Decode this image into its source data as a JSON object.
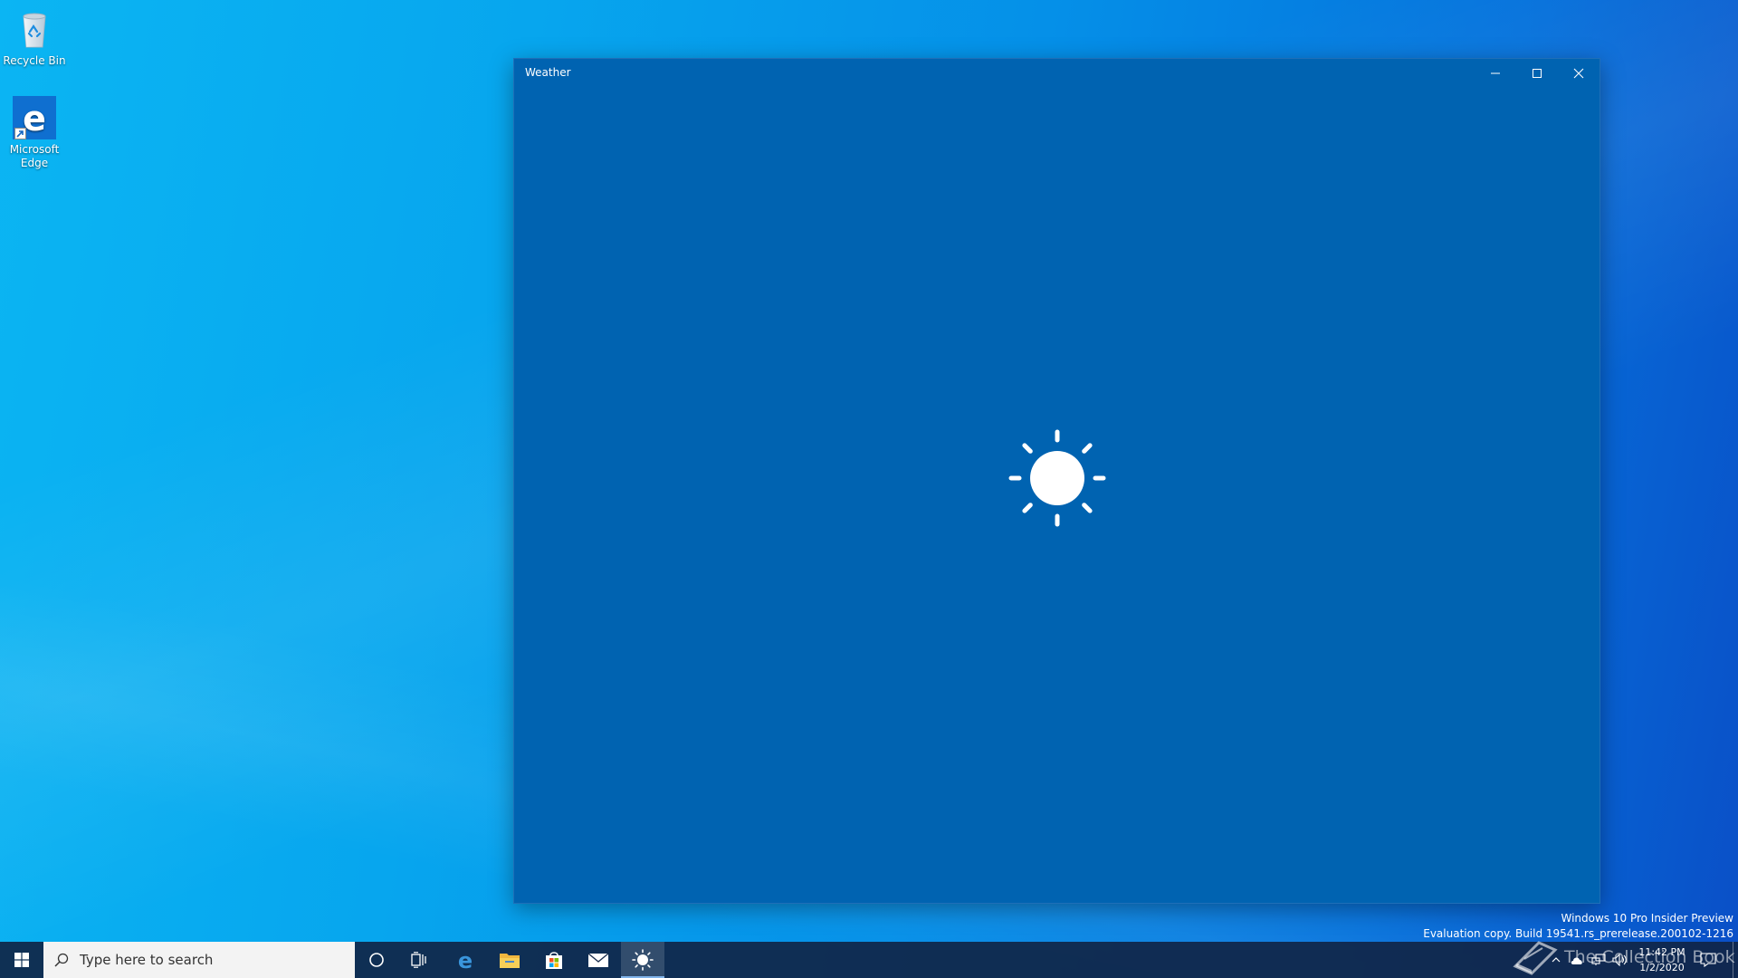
{
  "desktop": {
    "icons": [
      {
        "label": "Recycle Bin",
        "icon": "recycle-bin-icon"
      },
      {
        "label": "Microsoft\nEdge",
        "icon": "edge-icon"
      }
    ]
  },
  "window": {
    "title": "Weather",
    "controls": {
      "minimize": "minimize-icon",
      "maximize": "maximize-icon",
      "close": "close-icon"
    },
    "splash_icon": "sun-icon",
    "background": "#0063b1"
  },
  "watermark": {
    "line1": "Windows 10 Pro Insider Preview",
    "line2": "Evaluation copy. Build 19541.rs_prerelease.200102-1216"
  },
  "taskbar": {
    "search_placeholder": "Type here to search",
    "pinned": [
      "cortana-icon",
      "task-view-icon",
      "edge-icon",
      "file-explorer-icon",
      "store-icon",
      "mail-icon",
      "weather-icon"
    ],
    "active": "weather-icon",
    "clock": {
      "time": "11:42 PM",
      "date": "1/2/2020"
    }
  },
  "brand_overlay": {
    "text": "The Collection Book"
  }
}
